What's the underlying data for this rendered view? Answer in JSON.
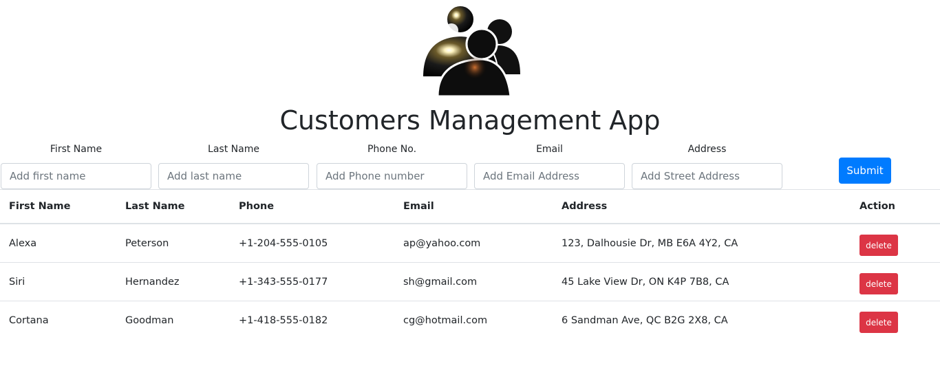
{
  "header": {
    "logo_icon": "customers-group-icon",
    "title": "Customers Management App"
  },
  "form": {
    "fields": [
      {
        "label": "First Name",
        "placeholder": "Add first name",
        "value": ""
      },
      {
        "label": "Last Name",
        "placeholder": "Add last name",
        "value": ""
      },
      {
        "label": "Phone No.",
        "placeholder": "Add Phone number",
        "value": ""
      },
      {
        "label": "Email",
        "placeholder": "Add Email Address",
        "value": ""
      },
      {
        "label": "Address",
        "placeholder": "Add Street Address",
        "value": ""
      }
    ],
    "submit_label": "Submit",
    "submit_color": "#007bff"
  },
  "table": {
    "columns": [
      "First Name",
      "Last Name",
      "Phone",
      "Email",
      "Address",
      "Action"
    ],
    "rows": [
      {
        "first": "Alexa",
        "last": "Peterson",
        "phone": "+1-204-555-0105",
        "email": "ap@yahoo.com",
        "address": "123, Dalhousie Dr, MB E6A 4Y2, CA",
        "action": "delete"
      },
      {
        "first": "Siri",
        "last": "Hernandez",
        "phone": "+1-343-555-0177",
        "email": "sh@gmail.com",
        "address": "45 Lake View Dr, ON K4P 7B8, CA",
        "action": "delete"
      },
      {
        "first": "Cortana",
        "last": "Goodman",
        "phone": "+1-418-555-0182",
        "email": "cg@hotmail.com",
        "address": "6 Sandman Ave, QC B2G 2X8, CA",
        "action": "delete"
      }
    ],
    "delete_color": "#dc3545"
  }
}
